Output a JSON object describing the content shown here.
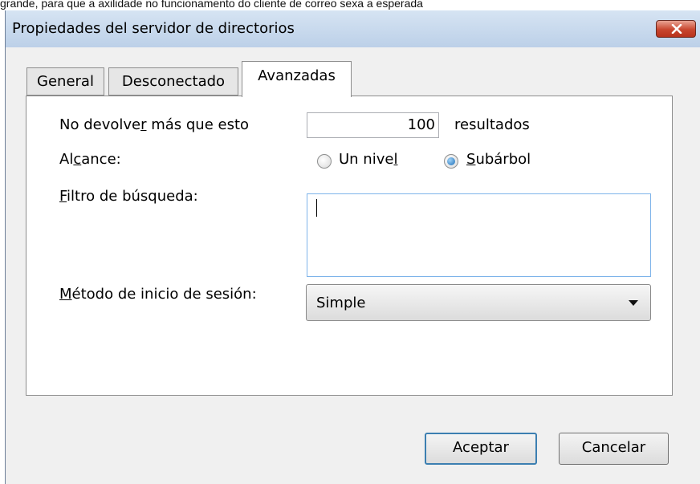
{
  "caption": "grande, para que a axilidade no funcionamento do cliente de correo sexa a esperada",
  "window": {
    "title": "Propiedades del servidor de directorios"
  },
  "tabs": [
    {
      "label": "General"
    },
    {
      "label": "Desconectado"
    },
    {
      "label": "Avanzadas"
    }
  ],
  "form": {
    "max_results": {
      "pre": "No devolve",
      "key": "r",
      "post": " más que esto",
      "value": "100",
      "suffix": "resultados"
    },
    "scope": {
      "pre": "Al",
      "key": "c",
      "post": "ance:"
    },
    "scope_one": {
      "pre": "Un nive",
      "key": "l",
      "post": ""
    },
    "scope_sub": {
      "pre": "",
      "key": "S",
      "post": "ubárbol"
    },
    "filter": {
      "pre": "",
      "key": "F",
      "post": "iltro de búsqueda:",
      "value": ""
    },
    "login": {
      "pre": "",
      "key": "M",
      "post": "étodo de inicio de sesión:",
      "value": "Simple"
    }
  },
  "buttons": {
    "accept": "Aceptar",
    "cancel": "Cancelar"
  },
  "icons": {
    "close": "close-icon",
    "dropdown": "chevron-down-icon"
  },
  "colors": {
    "radio_selected": "#1f6fb7",
    "focus_border": "#7eb4ea",
    "close_button": "#c8462e"
  }
}
